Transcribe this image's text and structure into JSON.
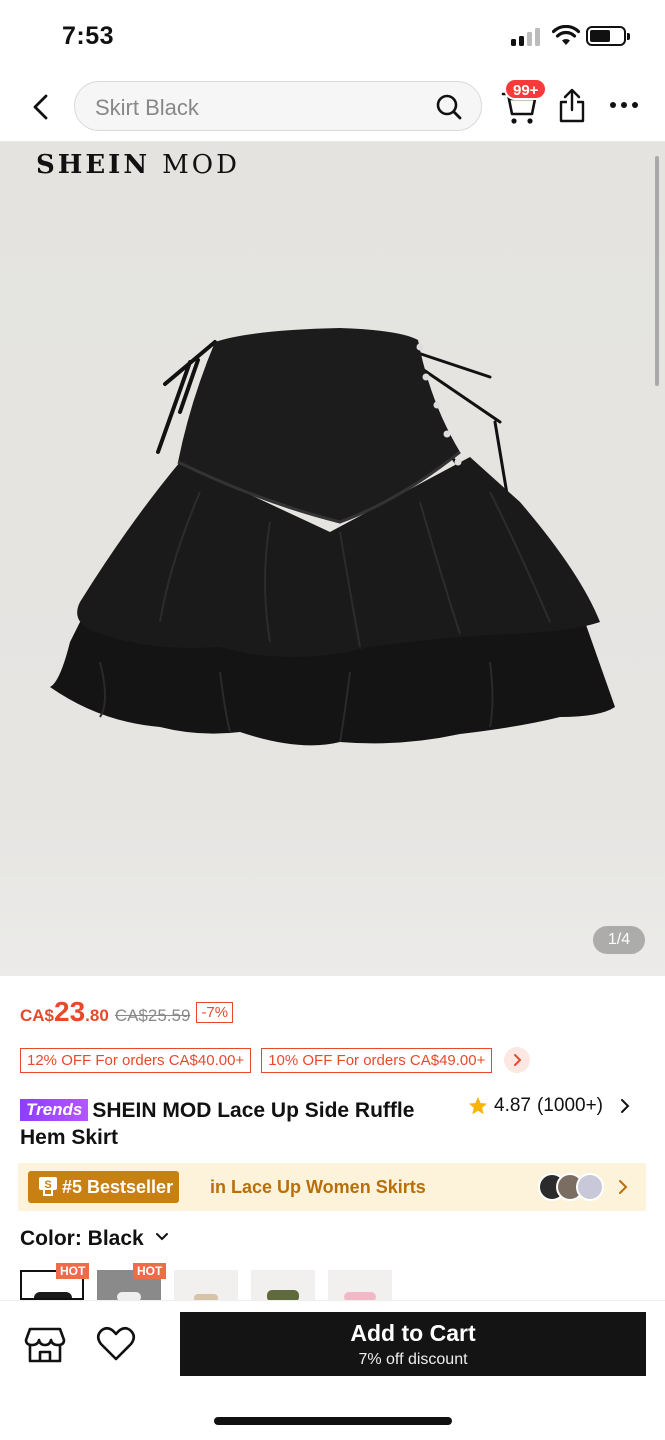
{
  "status_bar": {
    "time": "7:53"
  },
  "search": {
    "value": "Skirt Black"
  },
  "cart": {
    "badge": "99+"
  },
  "product": {
    "brand": "SHEIN",
    "brand_sub": "MOD",
    "image_page": "1/4",
    "price": {
      "currency": "CA$",
      "whole": "23",
      "cents": ".80",
      "original": "CA$25.59",
      "discount": "-7%"
    },
    "coupons": [
      "12% OFF For orders CA$40.00+",
      "10% OFF For orders CA$49.00+"
    ],
    "trends_label": "Trends",
    "title": "SHEIN MOD Lace Up Side Ruffle Hem Skirt",
    "rating": "4.87",
    "review_count": "(1000+)",
    "bestseller": {
      "rank": "#5 Bestseller",
      "category": "in Lace Up Women Skirts"
    },
    "color_label": "Color: Black",
    "swatch_hot_label": "HOT"
  },
  "bottom_bar": {
    "add_to_cart": "Add to Cart",
    "add_to_cart_sub": "7% off discount"
  },
  "colors": {
    "accent": "#e8492a",
    "bestseller": "#c98012",
    "trends": "#9b45ff",
    "cart_button": "#141414"
  },
  "icons": [
    "back-icon",
    "search-icon",
    "cart-icon",
    "share-icon",
    "more-icon",
    "star-icon",
    "chevron-right-icon",
    "chevron-down-icon",
    "store-icon",
    "heart-icon"
  ]
}
